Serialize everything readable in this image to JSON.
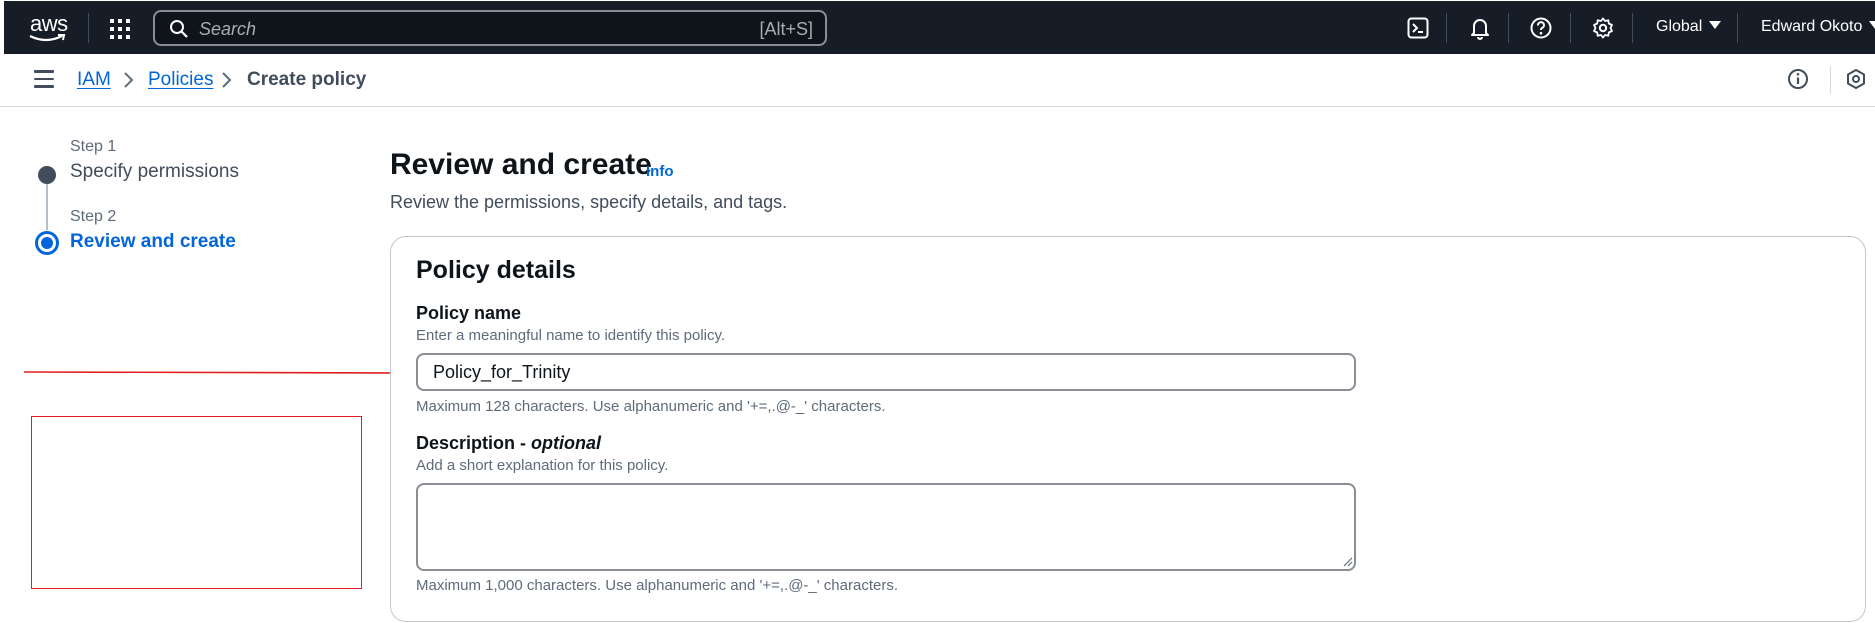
{
  "topbar": {
    "logo_text": "aws",
    "search_placeholder": "Search",
    "search_shortcut": "[Alt+S]",
    "icons": [
      "cloudshell-icon",
      "bell-icon",
      "help-icon",
      "settings-icon"
    ],
    "region": "Global",
    "user": "Edward Okoto",
    "colors": {
      "background": "#161d26",
      "text": "#ffffff"
    }
  },
  "breadcrumb": {
    "items": [
      {
        "label": "IAM",
        "link": true
      },
      {
        "label": "Policies",
        "link": true
      },
      {
        "label": "Create policy",
        "link": false
      }
    ]
  },
  "wizard": {
    "steps": [
      {
        "step_label": "Step 1",
        "title": "Specify permissions",
        "state": "completed"
      },
      {
        "step_label": "Step 2",
        "title": "Review and create",
        "state": "active"
      }
    ]
  },
  "main": {
    "title": "Review and create",
    "info_link": "Info",
    "description": "Review the permissions, specify details, and tags.",
    "policy_details": {
      "heading": "Policy details",
      "name_field": {
        "label": "Policy name",
        "description": "Enter a meaningful name to identify this policy.",
        "value": "Policy_for_Trinity",
        "constraint": "Maximum 128 characters. Use alphanumeric and '+=,.@-_' characters."
      },
      "description_field": {
        "label": "Description - ",
        "label_optional": "optional",
        "description": "Add a short explanation for this policy.",
        "value": "",
        "constraint": "Maximum 1,000 characters. Use alphanumeric and '+=,.@-_' characters."
      }
    }
  },
  "colors": {
    "link": "#0066d9",
    "annotation": "#e02020",
    "step_completed": "#414d5c"
  }
}
